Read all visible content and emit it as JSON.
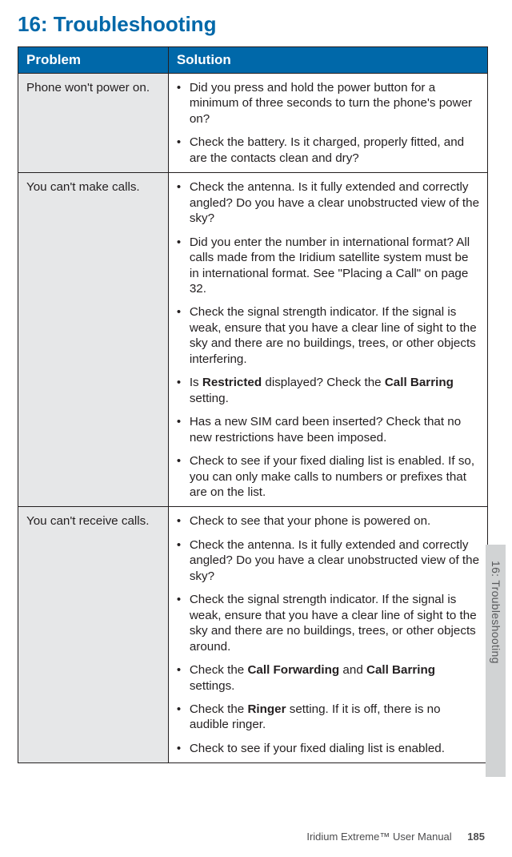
{
  "chapter_title": "16: Troubleshooting",
  "table": {
    "headers": {
      "problem": "Problem",
      "solution": "Solution"
    },
    "rows": [
      {
        "problem": "Phone won't power on.",
        "solutions": [
          "Did you press and hold the power button for a minimum of three seconds to turn the phone's power on?",
          "Check the battery. Is it charged, properly fitted, and are the contacts clean and dry?"
        ]
      },
      {
        "problem": "You can't make calls.",
        "solutions": [
          "Check the antenna. Is it fully extended and correctly angled? Do you have a clear unobstructed view of the sky?",
          "Did you enter the number in international format? All calls made from the Iridium satellite system must be in international format. See \"Placing a Call\" on page 32.",
          "Check the signal strength indicator. If the signal is weak, ensure that you have a clear line of sight to the sky and there are no buildings, trees, or other objects interfering.",
          {
            "prefix": "Is ",
            "bold1": "Restricted",
            "mid": " displayed? Check the ",
            "bold2": "Call Barring",
            "suffix": " setting."
          },
          "Has a new SIM card been inserted? Check that no new restrictions have been imposed.",
          "Check to see if your fixed dialing list is enabled. If so, you can only make calls to numbers or prefixes that are on the list."
        ]
      },
      {
        "problem": "You can't receive calls.",
        "solutions": [
          "Check to see that your phone is powered on.",
          "Check the antenna. Is it fully extended and correctly angled? Do you have a clear unobstructed view of the sky?",
          "Check the signal strength indicator. If the signal is weak, ensure that you have a clear line of sight to the sky and there are no buildings, trees, or other objects around.",
          {
            "prefix": "Check the ",
            "bold1": "Call Forwarding",
            "mid": " and ",
            "bold2": "Call Barring",
            "suffix": " settings."
          },
          {
            "prefix": "Check the ",
            "bold1": "Ringer",
            "mid": " setting. If it is off, there is no audible ringer.",
            "bold2": "",
            "suffix": ""
          },
          "Check to see if your fixed dialing list is enabled."
        ]
      }
    ]
  },
  "side_tab": "16: Troubleshooting",
  "footer": {
    "doc": "Iridium Extreme™ User Manual",
    "page": "185"
  }
}
